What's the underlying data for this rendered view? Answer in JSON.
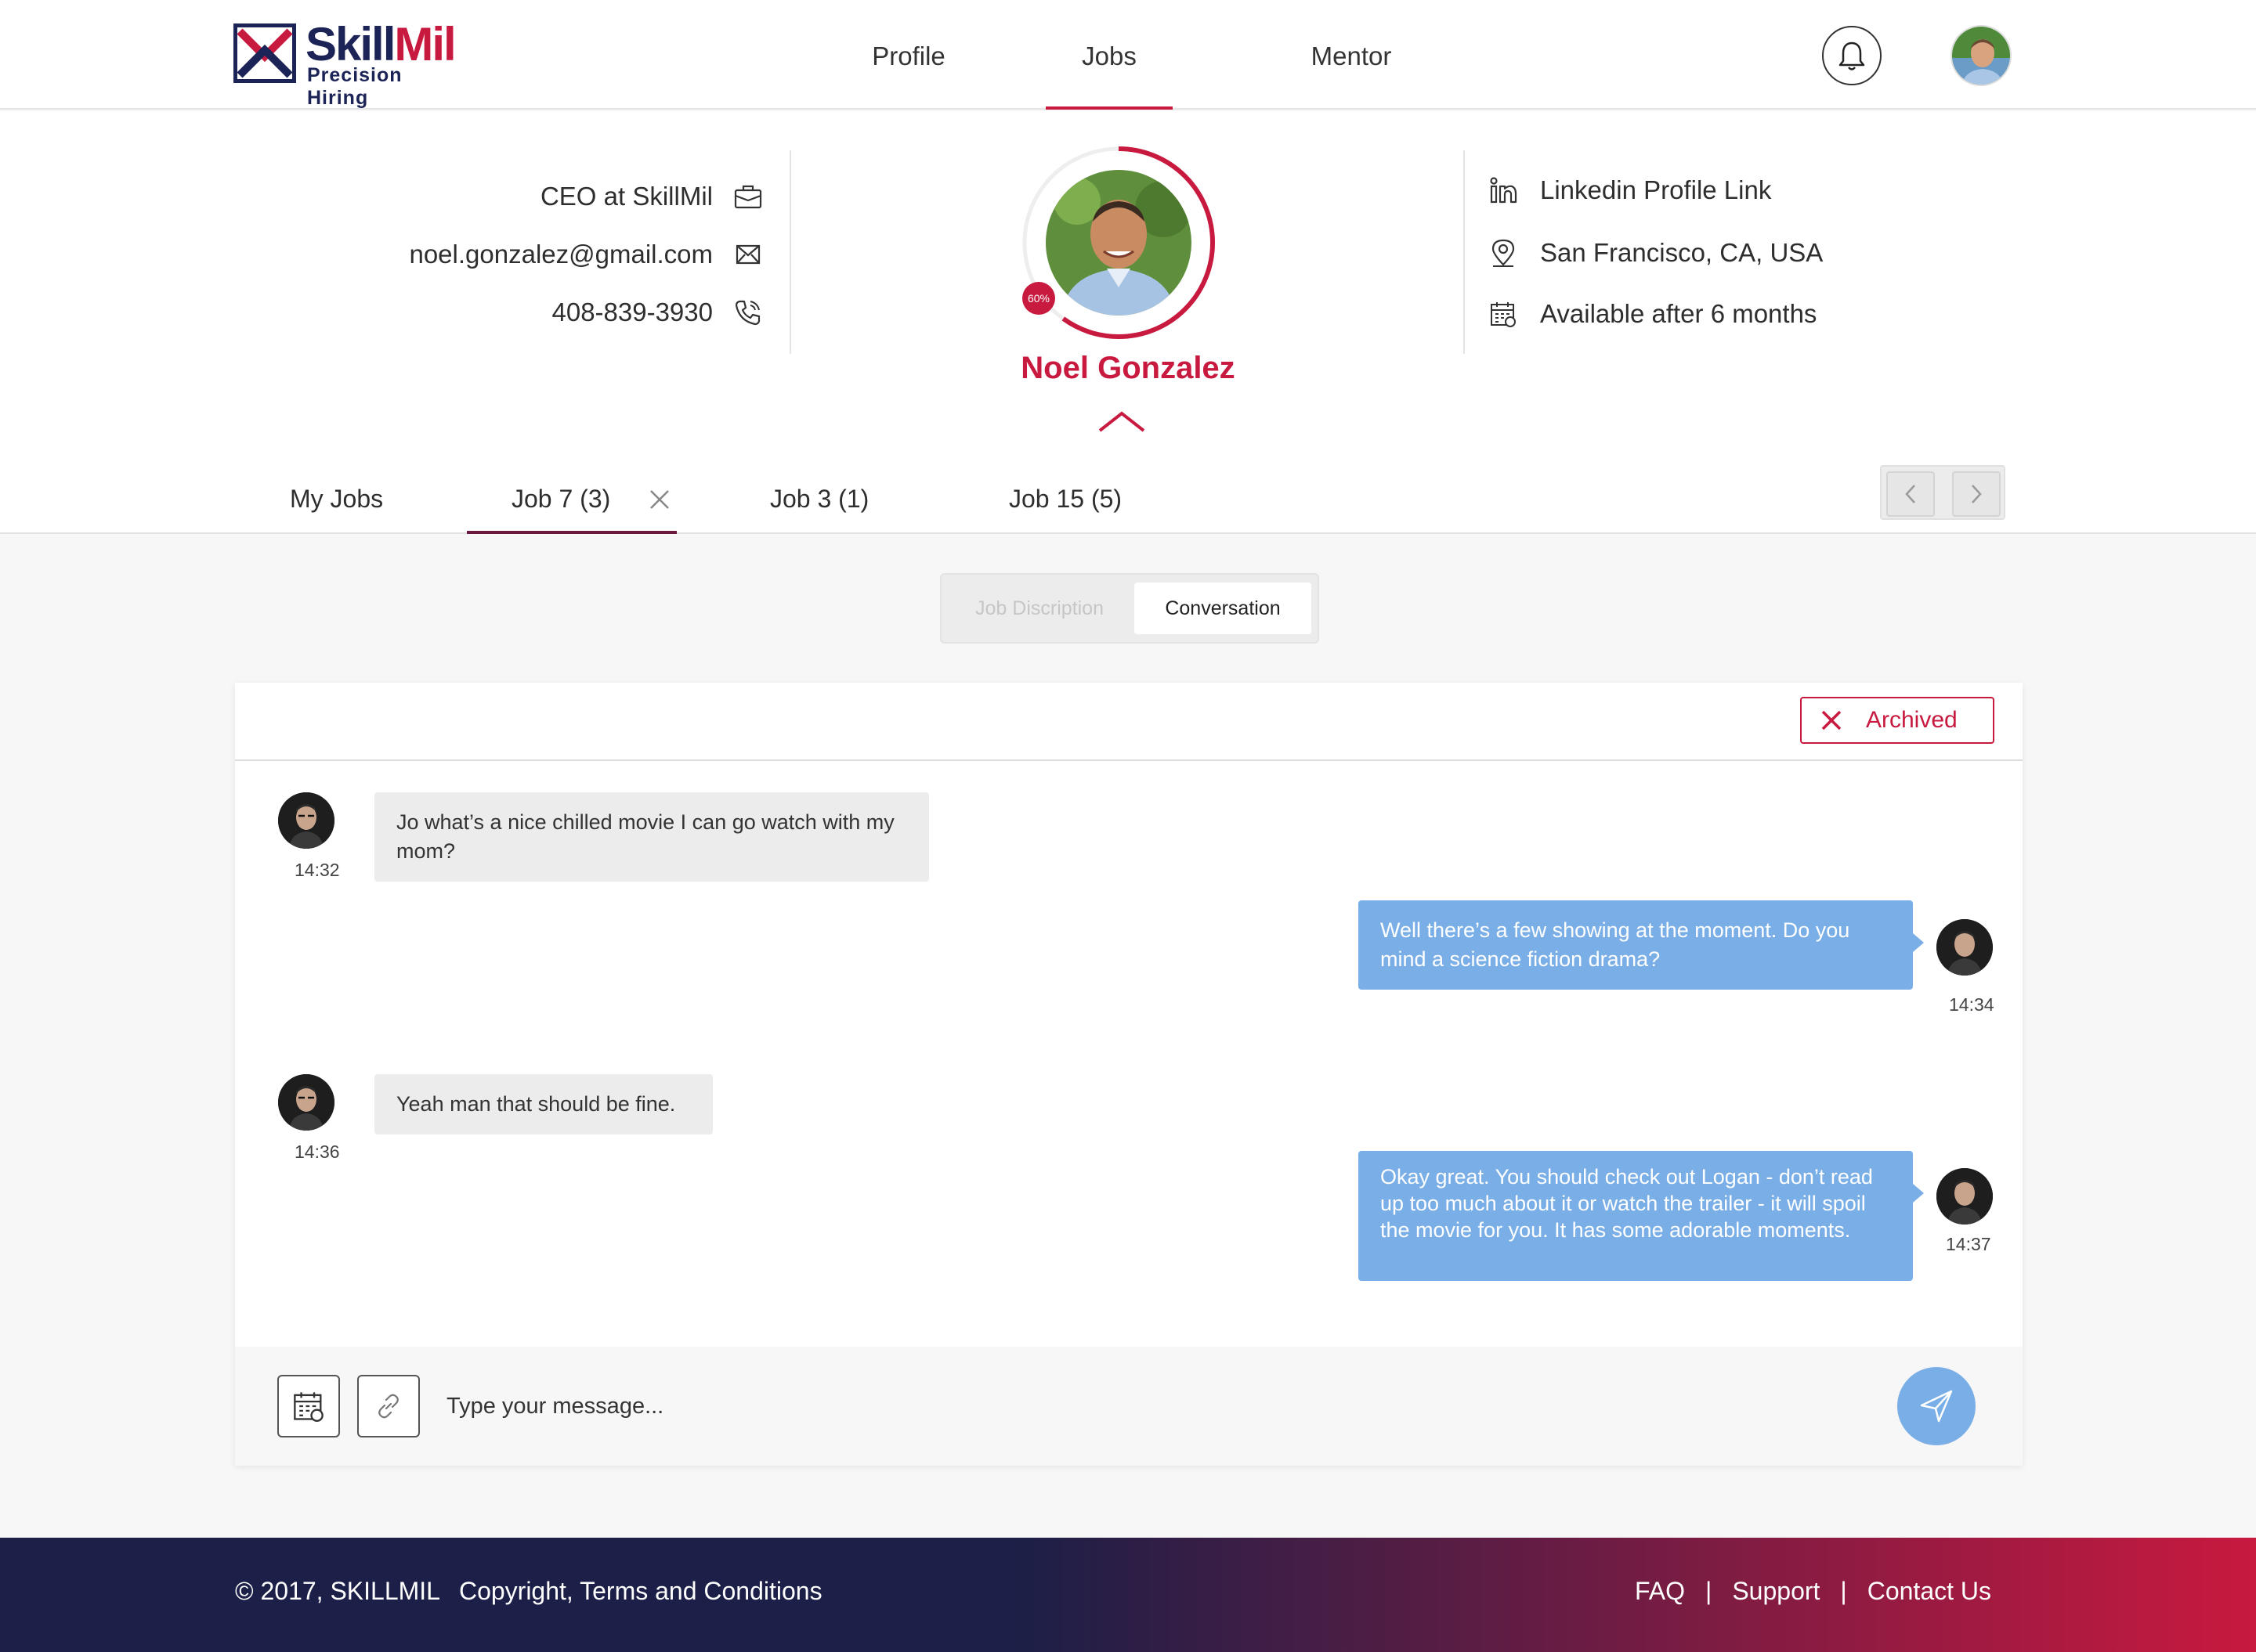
{
  "brand": {
    "name_a": "Skill",
    "name_b": "Mil",
    "tagline": "Precision Hiring"
  },
  "nav": {
    "items": [
      {
        "label": "Profile"
      },
      {
        "label": "Jobs"
      },
      {
        "label": "Mentor"
      }
    ],
    "active": "Jobs"
  },
  "profile": {
    "title": "CEO at SkillMil",
    "email": "noel.gonzalez@gmail.com",
    "phone": "408-839-3930",
    "name": "Noel Gonzalez",
    "completion_badge": "60%",
    "completion": 0.6,
    "linkedin": "Linkedin Profile Link",
    "location": "San Francisco, CA, USA",
    "availability": "Available after 6 months"
  },
  "tabs": [
    {
      "label": "My Jobs"
    },
    {
      "label": "Job 7 (3)"
    },
    {
      "label": "Job 3 (1)"
    },
    {
      "label": "Job 15 (5)"
    }
  ],
  "segment": {
    "inactive": "Job Discription",
    "active": "Conversation"
  },
  "chat": {
    "status": "Archived",
    "messages": [
      {
        "side": "in",
        "text": "Jo what’s a nice chilled movie I can go watch with my mom?",
        "time": "14:32"
      },
      {
        "side": "out",
        "text": "Well there’s a few showing at the moment. Do you mind a science fiction drama?",
        "time": "14:34"
      },
      {
        "side": "in",
        "text": "Yeah man that should be fine.",
        "time": "14:36"
      },
      {
        "side": "out",
        "text": "Okay great. You should check out Logan - don’t read up too much about it or watch the trailer - it will spoil the movie for you. It has some adorable moments.",
        "time": "14:37"
      }
    ],
    "input_placeholder": "Type your message..."
  },
  "footer": {
    "copyright": "© 2017, SKILLMIL",
    "terms": "Copyright, Terms and Conditions",
    "faq": "FAQ",
    "support": "Support",
    "contact": "Contact Us",
    "separator": "|"
  },
  "colors": {
    "accent": "#c8193f",
    "navy": "#1c2356",
    "bubble_out": "#7aaee6",
    "bubble_in": "#ececec"
  }
}
